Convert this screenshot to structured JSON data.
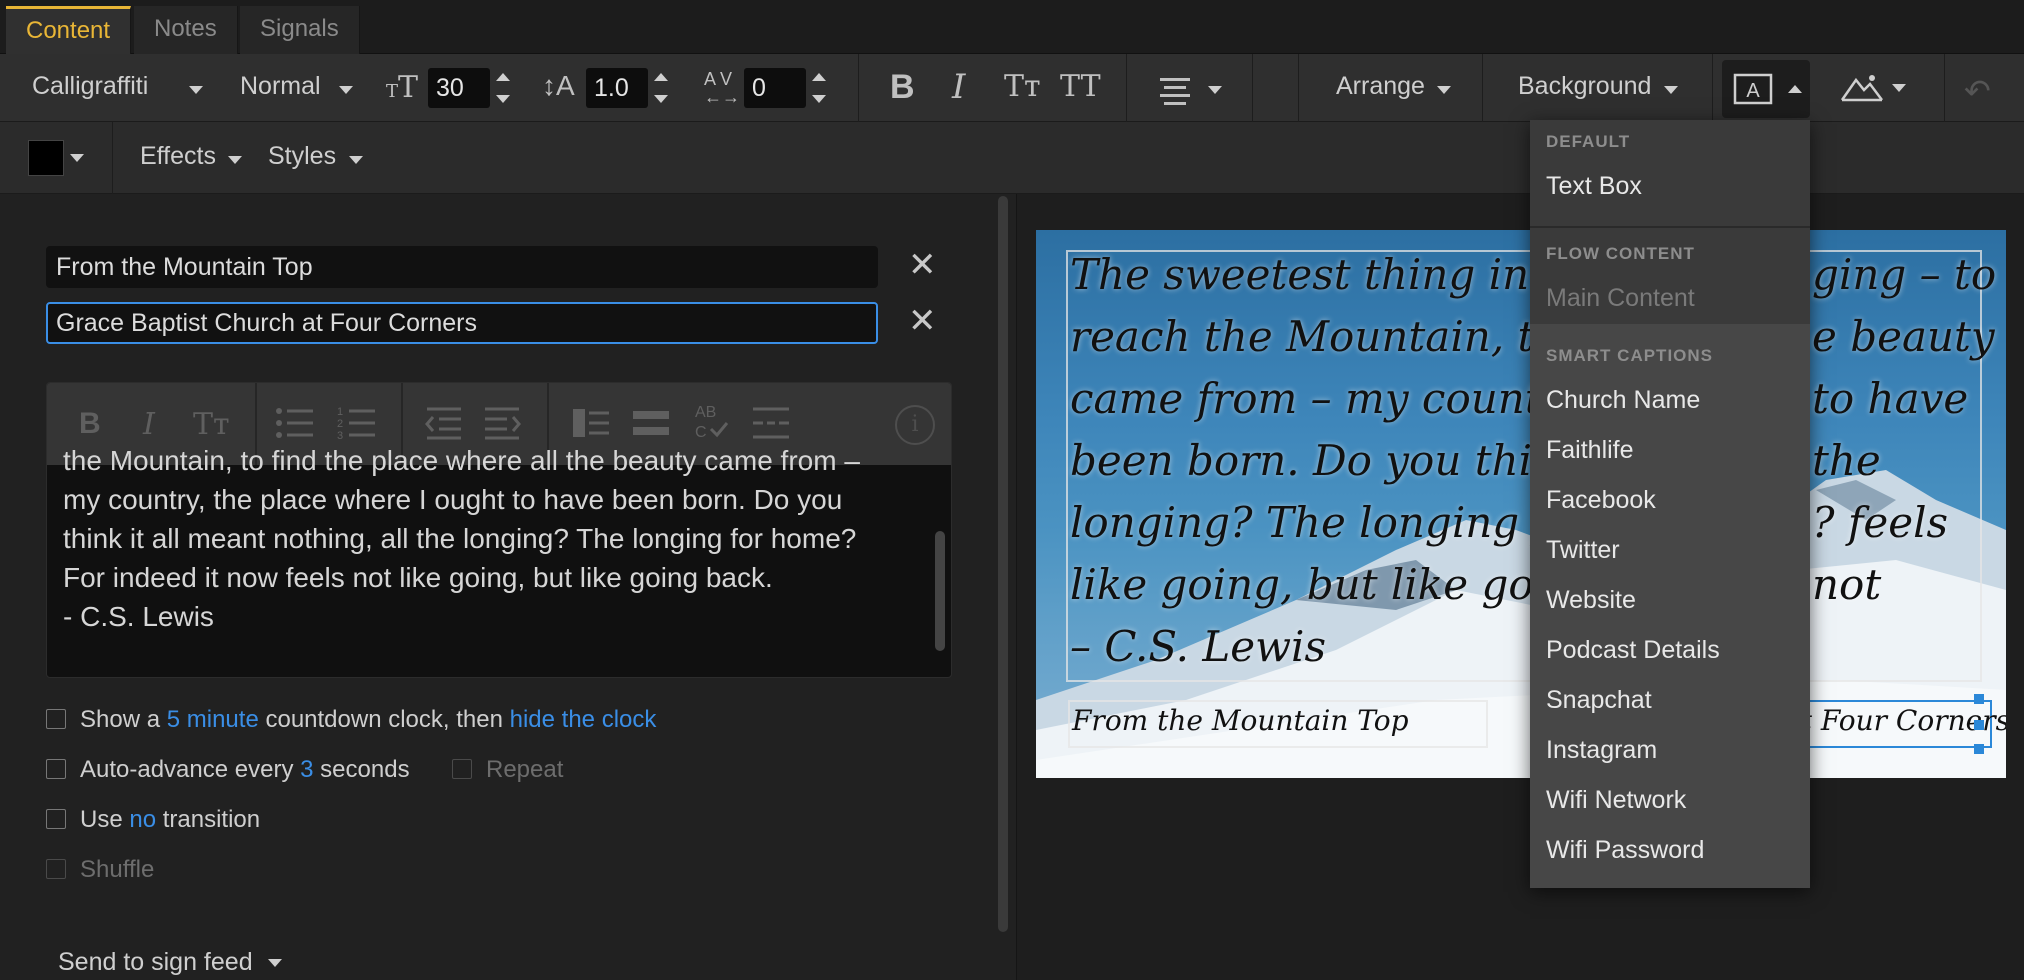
{
  "tabs": [
    {
      "label": "Content"
    },
    {
      "label": "Notes"
    },
    {
      "label": "Signals"
    }
  ],
  "toolbar": {
    "font_family": "Calligraffiti",
    "font_weight": "Normal",
    "font_size": "30",
    "line_height": "1.0",
    "tracking": "0",
    "bold_icon": "B",
    "italic_icon": "I",
    "smallcaps_icon": "Tт",
    "allcaps_icon": "TT",
    "arrange_label": "Arrange",
    "background_label": "Background",
    "effects_label": "Effects",
    "styles_label": "Styles",
    "text_color": "#000000"
  },
  "fields": {
    "field1": "From the Mountain Top",
    "field2": "Grace Baptist Church at Four Corners"
  },
  "editor": {
    "toolbar_icons": {
      "bold": "B",
      "italic": "I",
      "caps": "Tт",
      "info": "i"
    },
    "lines": [
      "the Mountain, to find the place where all the beauty came from –",
      "my country, the place where I ought to have been born. Do you",
      "think it all meant nothing, all the longing? The longing for home?",
      "For indeed it now feels not like going, but like going back.",
      "- C.S. Lewis"
    ]
  },
  "options": {
    "countdown": {
      "pre": "Show a",
      "minutes": "5 minute",
      "mid": "countdown clock, then",
      "action": "hide the clock"
    },
    "autoadvance": {
      "pre": "Auto-advance every",
      "seconds": "3",
      "post": "seconds",
      "repeat": "Repeat"
    },
    "transition": {
      "pre": "Use",
      "value": "no",
      "post": "transition"
    },
    "shuffle": "Shuffle",
    "sign_feed": "Send to sign feed"
  },
  "preview": {
    "lines": [
      "The sweetest thing in all my li",
      "reach the Mountain, to find the",
      "came from – my country, the pl",
      "been born. Do you think it all m",
      "longing? The longing for home?",
      "like going, but like going back.",
      "– C.S. Lewis"
    ],
    "right_lines": [
      "ging – to",
      "e beauty",
      "to have",
      "the",
      "? feels not"
    ],
    "caption_left": "From the Mountain Top",
    "caption_right": "at Four Corners"
  },
  "dropdown": {
    "sections": [
      {
        "title": "DEFAULT",
        "items": [
          "Text Box"
        ]
      },
      {
        "title": "FLOW CONTENT",
        "items": [
          "Main Content"
        ]
      },
      {
        "title": "SMART CAPTIONS",
        "items": [
          "Church Name",
          "Faithlife",
          "Facebook",
          "Twitter",
          "Website",
          "Podcast Details",
          "Snapchat",
          "Instagram",
          "Wifi Network",
          "Wifi Password"
        ]
      }
    ]
  }
}
